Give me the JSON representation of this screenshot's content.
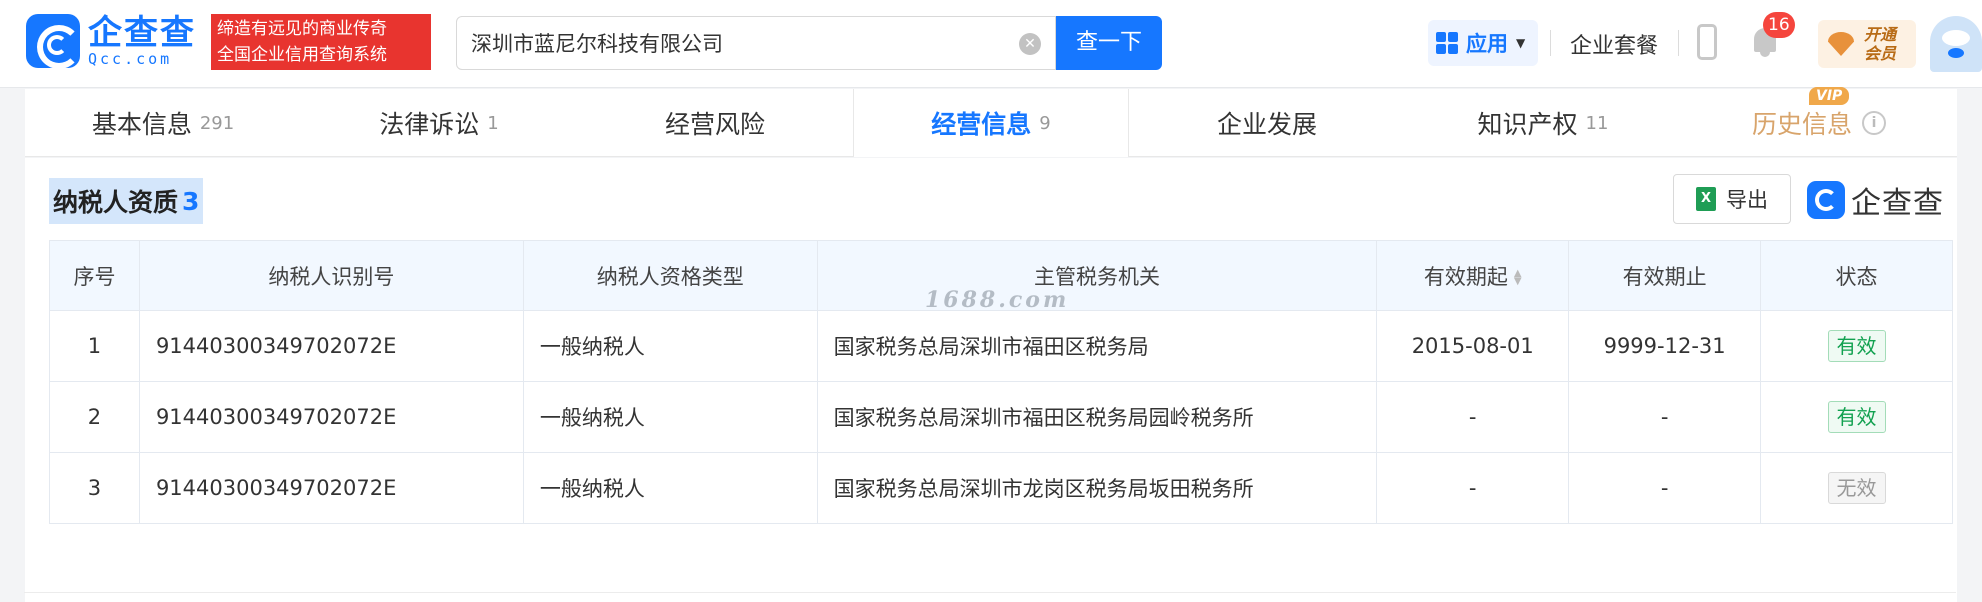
{
  "brand": {
    "name_cn": "企查查",
    "name_en": "Qcc.com",
    "slogan_line1": "缔造有远见的商业传奇",
    "slogan_line2": "全国企业信用查询系统"
  },
  "search": {
    "value": "深圳市蓝尼尔科技有限公司",
    "button_label": "查一下"
  },
  "header": {
    "apps_label": "应用",
    "package_label": "企业套餐",
    "notification_count": "16",
    "vip_line1": "开通",
    "vip_line2": "会员"
  },
  "tabs": [
    {
      "label": "基本信息",
      "count": "291"
    },
    {
      "label": "法律诉讼",
      "count": "1"
    },
    {
      "label": "经营风险",
      "count": ""
    },
    {
      "label": "经营信息",
      "count": "9"
    },
    {
      "label": "企业发展",
      "count": ""
    },
    {
      "label": "知识产权",
      "count": "11"
    },
    {
      "label": "历史信息",
      "count": "",
      "tag": "VIP"
    }
  ],
  "section": {
    "title": "纳税人资质",
    "count": "3",
    "export_label": "导出",
    "brand_label": "企查查"
  },
  "table": {
    "headers": [
      "序号",
      "纳税人识别号",
      "纳税人资格类型",
      "主管税务机关",
      "有效期起",
      "有效期止",
      "状态"
    ],
    "rows": [
      [
        "1",
        "91440300349702072E",
        "一般纳税人",
        "国家税务总局深圳市福田区税务局",
        "2015-08-01",
        "9999-12-31",
        "有效"
      ],
      [
        "2",
        "91440300349702072E",
        "一般纳税人",
        "国家税务总局深圳市福田区税务局园岭税务所",
        "-",
        "-",
        "有效"
      ],
      [
        "3",
        "91440300349702072E",
        "一般纳税人",
        "国家税务总局深圳市龙岗区税务局坂田税务所",
        "-",
        "-",
        "无效"
      ]
    ]
  },
  "watermark": "1688.com",
  "colors": {
    "accent": "#1677ff",
    "slogan_bg": "#e8342f",
    "valid": "#12a150",
    "invalid": "#999999"
  }
}
